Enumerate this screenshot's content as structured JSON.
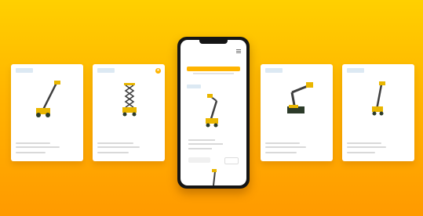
{
  "cards": [
    {
      "badge": "",
      "title": "",
      "favorite": false,
      "machine": "telescopic-boom-lift"
    },
    {
      "badge": "",
      "title": "",
      "favorite": true,
      "machine": "scissor-lift"
    },
    {
      "badge": "",
      "title": "",
      "favorite": false,
      "machine": "articulating-boom-lift"
    },
    {
      "badge": "",
      "title": "",
      "favorite": false,
      "machine": "vertical-mast-lift"
    }
  ],
  "phone": {
    "logo": "",
    "product_badge": "",
    "product_link": "",
    "product_title": "",
    "secondary_button": "",
    "primary_button": ""
  },
  "colors": {
    "background_top": "#ffd000",
    "background_bottom": "#ff9a00",
    "accent": "#ffb400",
    "badge_text": "#3b86c6",
    "machine_body": "#e9b600",
    "machine_base": "#2c3b2a"
  }
}
